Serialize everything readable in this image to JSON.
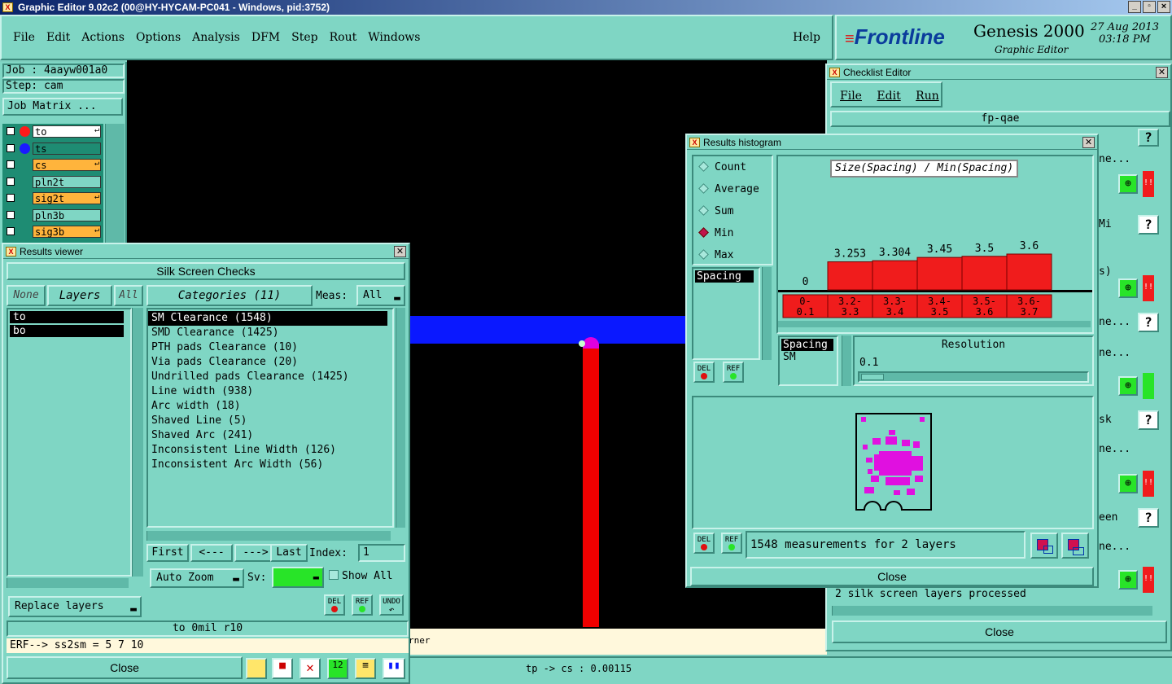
{
  "window_title": "Graphic Editor 9.02c2 (00@HY-HYCAM-PC041 - Windows, pid:3752)",
  "menubar": [
    "File",
    "Edit",
    "Actions",
    "Options",
    "Analysis",
    "DFM",
    "Step",
    "Rout",
    "Windows"
  ],
  "help_label": "Help",
  "brand": {
    "logo": "Frontline",
    "product": "Genesis 2000",
    "subtitle": "Graphic Editor",
    "date": "27 Aug 2013",
    "time": "03:18 PM"
  },
  "job": {
    "job_label": "Job : 4aayw001a0",
    "step_label": "Step: cam",
    "matrix_button": "Job Matrix ..."
  },
  "layers": [
    {
      "name": "to",
      "color": "#ff1a1a",
      "bg": "#ffffff",
      "flag": true
    },
    {
      "name": "ts",
      "color": "#1a1aff",
      "bg": "#1e8c73",
      "flag": false
    },
    {
      "name": "cs",
      "color": "",
      "bg": "#ffb43c",
      "flag": true
    },
    {
      "name": "pln2t",
      "color": "",
      "bg": "#7fd6c4",
      "flag": false
    },
    {
      "name": "sig2t",
      "color": "",
      "bg": "#ffb43c",
      "flag": true
    },
    {
      "name": "pln3b",
      "color": "",
      "bg": "#7fd6c4",
      "flag": false
    },
    {
      "name": "sig3b",
      "color": "",
      "bg": "#ffb43c",
      "flag": true
    }
  ],
  "results_viewer": {
    "title": "Results viewer",
    "header": "Silk Screen Checks",
    "none_btn": "None",
    "layers_btn": "Layers",
    "all_btn": "All",
    "layer_items": [
      "to",
      "bo"
    ],
    "categories_btn": "Categories (11)",
    "meas_label": "Meas:",
    "meas_value": "All",
    "categories": [
      "SM Clearance (1548)",
      "SMD Clearance (1425)",
      "PTH pads Clearance (10)",
      "Via pads Clearance (20)",
      "Undrilled pads Clearance (1425)",
      "Line width (938)",
      "Arc width (18)",
      "Shaved Line (5)",
      "Shaved Arc (241)",
      "Inconsistent Line Width (126)",
      "Inconsistent Arc Width (56)"
    ],
    "nav": {
      "first": "First",
      "prev": "<---",
      "next": "--->",
      "last": "Last",
      "index_label": "Index:",
      "index_value": "1"
    },
    "auto_zoom": "Auto Zoom",
    "sv_label": "Sv:",
    "show_all": "Show All",
    "replace_layers": "Replace layers",
    "del": "DEL",
    "ref": "REF",
    "undo": "UNDO",
    "status": "to  0mil  r10",
    "erf_line": "ERF--> ss2sm = 5 7 10",
    "close": "Close"
  },
  "canvas_bottom": {
    "text1": "rner",
    "text2": "tp -> cs : 0.00115"
  },
  "checklist_editor": {
    "title": "Checklist Editor",
    "menu": [
      "File",
      "Edit",
      "Run"
    ],
    "name": "fp-qae",
    "side_fragments": [
      "ne...",
      "Mi",
      "s)",
      "ne...",
      "ne...",
      "sk",
      "ne...",
      "een",
      "ne..."
    ],
    "bottom_text": "2 silk screen layers processed",
    "close": "Close"
  },
  "histogram": {
    "title": "Results histogram",
    "modes": [
      {
        "label": "Count",
        "selected": false
      },
      {
        "label": "Average",
        "selected": false
      },
      {
        "label": "Sum",
        "selected": false
      },
      {
        "label": "Min",
        "selected": true
      },
      {
        "label": "Max",
        "selected": false
      }
    ],
    "chart_title": "Size(Spacing) / Min(Spacing)",
    "measure_list": [
      "Spacing"
    ],
    "sub_list": [
      "Spacing",
      "SM"
    ],
    "resolution_label": "Resolution",
    "resolution_value": "0.1",
    "del": "DEL",
    "ref": "REF",
    "summary": "1548 measurements for 2 layers",
    "close": "Close",
    "chart_data": {
      "type": "bar",
      "categories": [
        "0-\n0.1",
        "3.2-\n3.3",
        "3.3-\n3.4",
        "3.4-\n3.5",
        "3.5-\n3.6",
        "3.6-\n3.7"
      ],
      "values": [
        0,
        3.253,
        3.304,
        3.45,
        3.5,
        3.6
      ],
      "labels": [
        "0",
        "3.253",
        "3.304",
        "3.45",
        "3.5",
        "3.6"
      ],
      "bar_color": "#f01c1c"
    }
  },
  "colors": {
    "panel": "#7fd6c4",
    "canvas": "#000000",
    "selection": "#000000"
  }
}
